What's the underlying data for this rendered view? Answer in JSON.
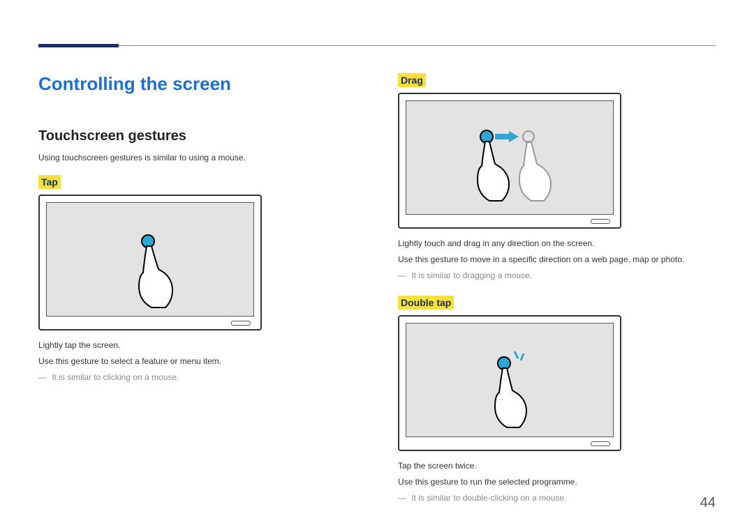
{
  "page_number": "44",
  "title": "Controlling the screen",
  "section_heading": "Touchscreen gestures",
  "section_intro": "Using touchscreen gestures is similar to using a mouse.",
  "gestures": {
    "tap": {
      "title": "Tap",
      "desc1": "Lightly tap the screen.",
      "desc2": "Use this gesture to select a feature or menu item.",
      "note": " It is similar to clicking on a mouse."
    },
    "drag": {
      "title": "Drag",
      "desc1": "Lightly touch and drag in any direction on the screen.",
      "desc2": "Use this gesture to move in a specific direction on a web page, map or photo.",
      "note": " It is similar to dragging a mouse."
    },
    "double_tap": {
      "title": "Double tap",
      "desc1": "Tap the screen twice.",
      "desc2": "Use this gesture to run the selected programme.",
      "note": " It is similar to double-clicking on a mouse."
    }
  }
}
